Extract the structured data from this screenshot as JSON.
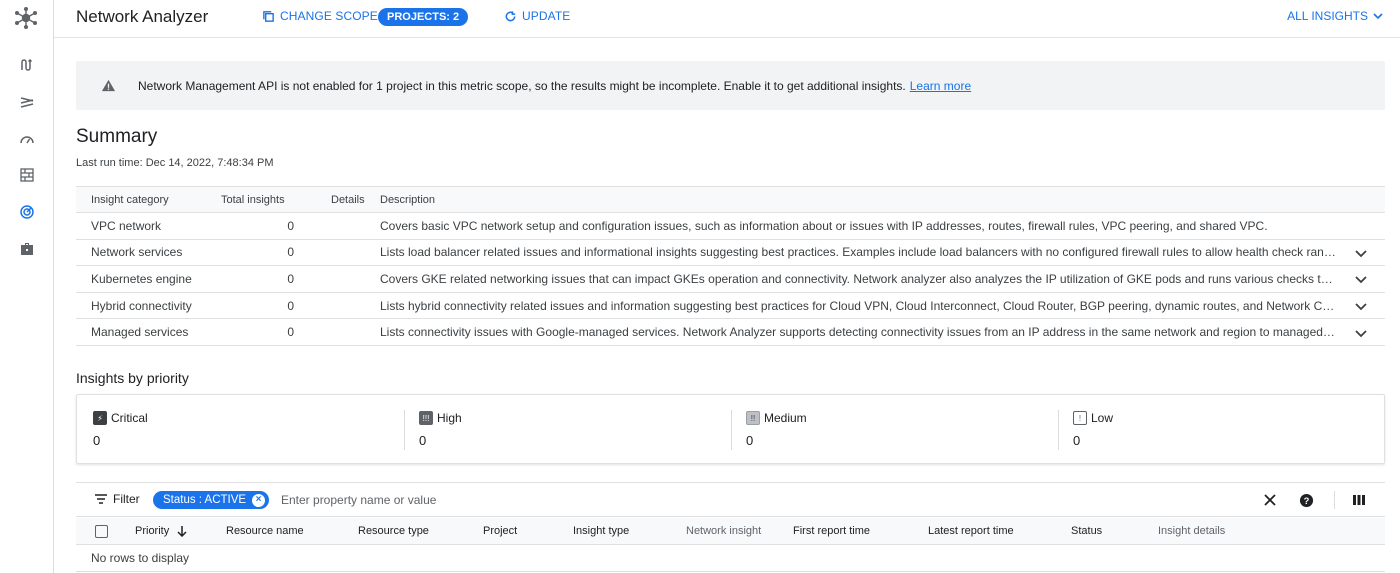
{
  "header": {
    "title": "Network Analyzer",
    "change_scope_label": "CHANGE SCOPE",
    "projects_chip": "PROJECTS: 2",
    "update_label": "UPDATE",
    "all_insights_label": "ALL INSIGHTS"
  },
  "rail": {
    "items": [
      "connectivity-icon",
      "topology-icon",
      "performance-icon",
      "firewall-icon",
      "network-analyzer-icon",
      "briefcase-icon"
    ],
    "active_index": 4
  },
  "banner": {
    "text": "Network Management API is not enabled for 1 project in this metric scope, so the results might be incomplete. Enable it to get additional insights.",
    "link": "Learn more"
  },
  "summary": {
    "title": "Summary",
    "last_run": "Last run time: Dec 14, 2022, 7:48:34 PM",
    "columns": [
      "Insight category",
      "Total insights",
      "Details",
      "Description"
    ],
    "rows": [
      {
        "category": "VPC network",
        "total": "0",
        "description": "Covers basic VPC network setup and configuration issues, such as information about or issues with IP addresses, routes, firewall rules, VPC peering, and shared VPC.",
        "expandable": false
      },
      {
        "category": "Network services",
        "total": "0",
        "description": "Lists load balancer related issues and informational insights suggesting best practices. Examples include load balancers with no configured firewall rules to allow health check ran…",
        "expandable": true
      },
      {
        "category": "Kubernetes engine",
        "total": "0",
        "description": "Covers GKE related networking issues that can impact GKEs operation and connectivity. Network analyzer also analyzes the IP utilization of GKE pods and runs various checks to v…",
        "expandable": true
      },
      {
        "category": "Hybrid connectivity",
        "total": "0",
        "description": "Lists hybrid connectivity related issues and information suggesting best practices for Cloud VPN, Cloud Interconnect, Cloud Router, BGP peering, dynamic routes, and Network Con…",
        "expandable": true
      },
      {
        "category": "Managed services",
        "total": "0",
        "description": "Lists connectivity issues with Google-managed services. Network Analyzer supports detecting connectivity issues from an IP address in the same network and region to managed …",
        "expandable": true
      }
    ]
  },
  "priority": {
    "title": "Insights by priority",
    "items": [
      {
        "label": "Critical",
        "value": "0",
        "glyph": "⚡"
      },
      {
        "label": "High",
        "value": "0",
        "glyph": "!!!"
      },
      {
        "label": "Medium",
        "value": "0",
        "glyph": "!!"
      },
      {
        "label": "Low",
        "value": "0",
        "glyph": "!"
      }
    ]
  },
  "filter": {
    "label": "Filter",
    "chip": "Status : ACTIVE",
    "placeholder": "Enter property name or value"
  },
  "insights_table": {
    "columns": [
      "Priority",
      "Resource name",
      "Resource type",
      "Project",
      "Insight type",
      "Network insight",
      "First report time",
      "Latest report time",
      "Status",
      "Insight details"
    ],
    "empty_text": "No rows to display"
  },
  "colors": {
    "accent": "#1a73e8",
    "border": "#e0e0e0",
    "banner_bg": "#f1f3f4"
  }
}
